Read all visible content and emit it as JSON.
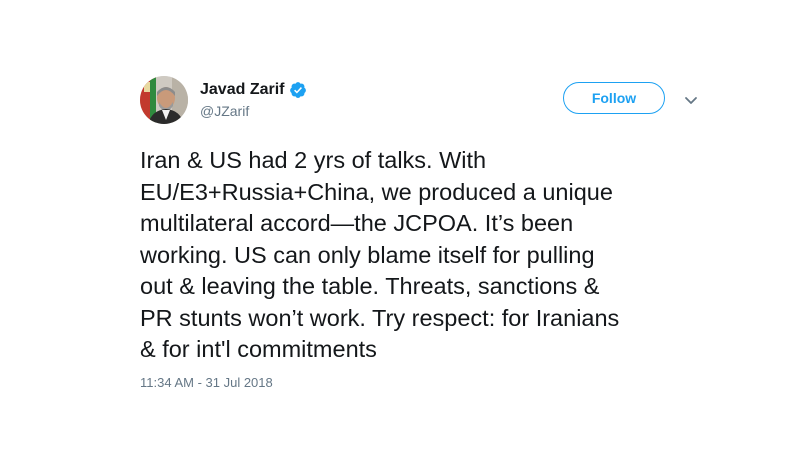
{
  "tweet": {
    "author": {
      "display_name": "Javad Zarif",
      "handle": "@JZarif",
      "verified": true
    },
    "follow_label": "Follow",
    "more_icon": "chevron-down-icon",
    "text_lines": [
      "Iran & US had 2 yrs of talks. With",
      "EU/E3+Russia+China, we produced a unique",
      "multilateral accord—the JCPOA. It’s been",
      "working. US can only blame itself for pulling",
      "out & leaving the table. Threats, sanctions &",
      "PR stunts won’t work. Try respect: for Iranians",
      "& for int'l commitments"
    ],
    "timestamp": "11:34 AM - 31 Jul 2018"
  },
  "colors": {
    "accent": "#1da1f2",
    "text": "#14171a",
    "muted": "#657786",
    "background": "#ffffff"
  }
}
